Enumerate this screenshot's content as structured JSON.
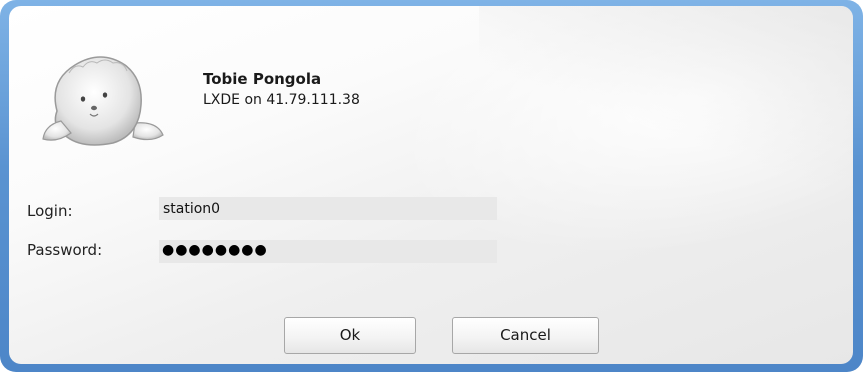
{
  "user": {
    "name": "Tobie Pongola",
    "session": "LXDE on 41.79.111.38",
    "avatar_icon": "seal-avatar-icon"
  },
  "form": {
    "login_label": "Login:",
    "login_value": "station0",
    "password_label": "Password:",
    "password_mask": "●●●●●●●●"
  },
  "buttons": {
    "ok_label": "Ok",
    "cancel_label": "Cancel"
  },
  "colors": {
    "frame_blue": "#5a93d1",
    "field_bg": "#e8e8e8"
  }
}
